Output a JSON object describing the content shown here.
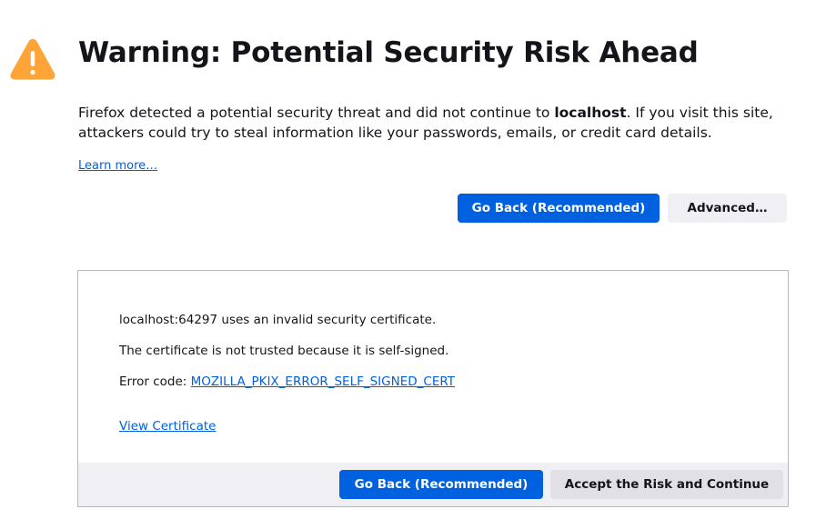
{
  "header": {
    "icon": "warning-triangle-icon",
    "icon_color": "#ffa436",
    "title": "Warning: Potential Security Risk Ahead"
  },
  "description": {
    "before": "Firefox detected a potential security threat and did not continue to ",
    "host": "localhost",
    "after": ". If you visit this site, attackers could try to steal information like your passwords, emails, or credit card details."
  },
  "learn_more": "Learn more…",
  "actions": {
    "go_back": "Go Back (Recommended)",
    "advanced": "Advanced…"
  },
  "advanced_panel": {
    "invalid_cert": "localhost:64297 uses an invalid security certificate.",
    "reason": "The certificate is not trusted because it is self-signed.",
    "error_code_label": "Error code: ",
    "error_code": "MOZILLA_PKIX_ERROR_SELF_SIGNED_CERT",
    "view_certificate": "View Certificate",
    "go_back": "Go Back (Recommended)",
    "accept": "Accept the Risk and Continue"
  },
  "colors": {
    "accent": "#0061e0",
    "secondary_button": "#f0f0f4",
    "text": "#15141a",
    "warning": "#ffa436"
  }
}
